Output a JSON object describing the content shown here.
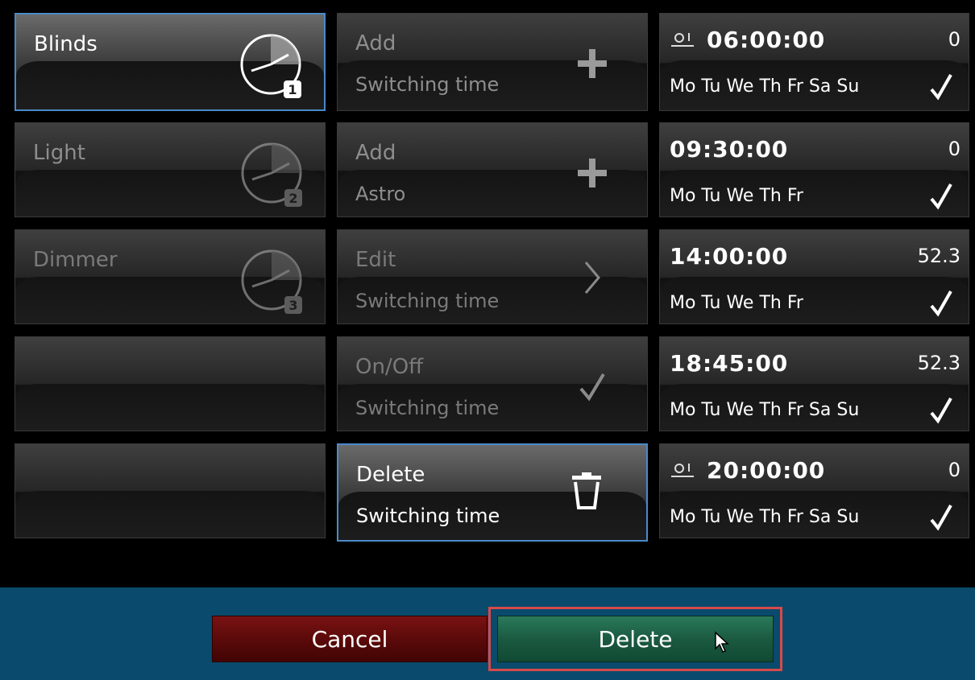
{
  "channels": [
    {
      "label": "Blinds",
      "badge": "1",
      "selected": true
    },
    {
      "label": "Light",
      "badge": "2",
      "selected": false
    },
    {
      "label": "Dimmer",
      "badge": "3",
      "selected": false
    },
    {
      "label": "",
      "badge": "",
      "selected": false
    },
    {
      "label": "",
      "badge": "",
      "selected": false
    }
  ],
  "actions": [
    {
      "title": "Add",
      "subtitle": "Switching time",
      "icon": "plus-icon"
    },
    {
      "title": "Add",
      "subtitle": "Astro",
      "icon": "plus-icon"
    },
    {
      "title": "Edit",
      "subtitle": "Switching time",
      "icon": "chevron-right-icon"
    },
    {
      "title": "On/Off",
      "subtitle": "Switching time",
      "icon": "check-icon"
    },
    {
      "title": "Delete",
      "subtitle": "Switching time",
      "icon": "trash-icon",
      "selected": true
    }
  ],
  "schedules": [
    {
      "time": "06:00:00",
      "value": "0",
      "days": "Mo Tu We Th Fr Sa Su",
      "astro": true
    },
    {
      "time": "09:30:00",
      "value": "0",
      "days": "Mo Tu We Th Fr",
      "astro": false
    },
    {
      "time": "14:00:00",
      "value": "52.3",
      "days": "Mo Tu We Th Fr",
      "astro": false
    },
    {
      "time": "18:45:00",
      "value": "52.3",
      "days": "Mo Tu We Th Fr Sa Su",
      "astro": false
    },
    {
      "time": "20:00:00",
      "value": "0",
      "days": "Mo Tu We Th Fr Sa Su",
      "astro": true
    }
  ],
  "buttons": {
    "cancel": "Cancel",
    "delete": "Delete"
  },
  "colors": {
    "selection": "#4a8ac8",
    "bar": "#0a4a6c",
    "cancel": "#6a0e0e",
    "delete": "#1b5a40",
    "highlight": "#d64a4a"
  }
}
